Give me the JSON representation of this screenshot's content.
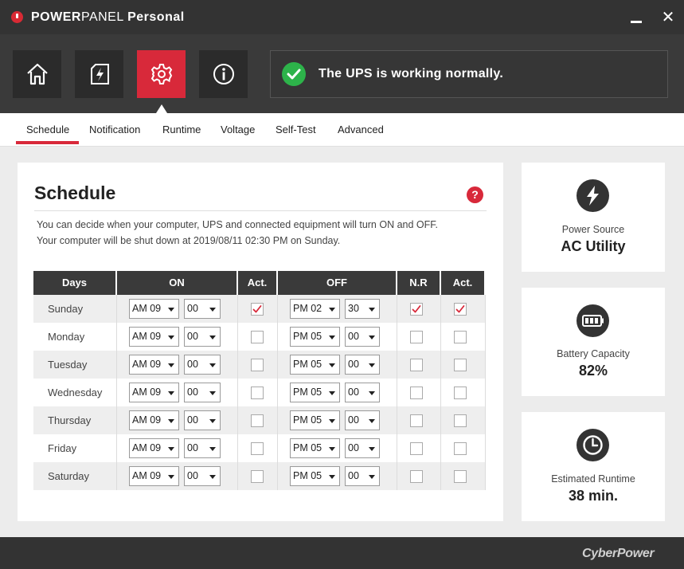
{
  "app": {
    "title_bold": "POWER",
    "title_rest": "PANEL",
    "title_suffix": "Personal"
  },
  "nav": {
    "buttons": [
      {
        "icon": "home-icon",
        "active": false
      },
      {
        "icon": "power-document-icon",
        "active": false
      },
      {
        "icon": "gear-icon",
        "active": true
      },
      {
        "icon": "info-icon",
        "active": false
      }
    ]
  },
  "status": {
    "icon": "check-circle-icon",
    "message": "The UPS is working normally.",
    "color": "#2db34a"
  },
  "tabs": [
    "Schedule",
    "Notification",
    "Runtime",
    "Voltage",
    "Self-Test",
    "Advanced"
  ],
  "active_tab": "Schedule",
  "schedule": {
    "title": "Schedule",
    "help_label": "?",
    "description_1": "You can decide when your computer, UPS and connected equipment will turn ON and OFF.",
    "description_2": "Your computer will be shut down at 2019/08/11 02:30 PM on Sunday.",
    "columns": [
      "Days",
      "ON",
      "Act.",
      "OFF",
      "N.R",
      "Act."
    ],
    "rows": [
      {
        "day": "Sunday",
        "on_hour": "AM 09",
        "on_min": "00",
        "on_act": true,
        "off_hour": "PM 02",
        "off_min": "30",
        "nr": true,
        "off_act": true
      },
      {
        "day": "Monday",
        "on_hour": "AM 09",
        "on_min": "00",
        "on_act": false,
        "off_hour": "PM 05",
        "off_min": "00",
        "nr": false,
        "off_act": false
      },
      {
        "day": "Tuesday",
        "on_hour": "AM 09",
        "on_min": "00",
        "on_act": false,
        "off_hour": "PM 05",
        "off_min": "00",
        "nr": false,
        "off_act": false
      },
      {
        "day": "Wednesday",
        "on_hour": "AM 09",
        "on_min": "00",
        "on_act": false,
        "off_hour": "PM 05",
        "off_min": "00",
        "nr": false,
        "off_act": false
      },
      {
        "day": "Thursday",
        "on_hour": "AM 09",
        "on_min": "00",
        "on_act": false,
        "off_hour": "PM 05",
        "off_min": "00",
        "nr": false,
        "off_act": false
      },
      {
        "day": "Friday",
        "on_hour": "AM 09",
        "on_min": "00",
        "on_act": false,
        "off_hour": "PM 05",
        "off_min": "00",
        "nr": false,
        "off_act": false
      },
      {
        "day": "Saturday",
        "on_hour": "AM 09",
        "on_min": "00",
        "on_act": false,
        "off_hour": "PM 05",
        "off_min": "00",
        "nr": false,
        "off_act": false
      }
    ]
  },
  "side": {
    "power_source": {
      "icon": "lightning-icon",
      "label": "Power Source",
      "value": "AC Utility"
    },
    "battery": {
      "icon": "battery-icon",
      "label": "Battery Capacity",
      "value": "82%"
    },
    "runtime": {
      "icon": "clock-icon",
      "label": "Estimated Runtime",
      "value": "38 min."
    }
  },
  "footer": {
    "brand": "CyberPower"
  },
  "colors": {
    "accent": "#d8293a",
    "dark": "#333333",
    "ok": "#2db34a"
  }
}
